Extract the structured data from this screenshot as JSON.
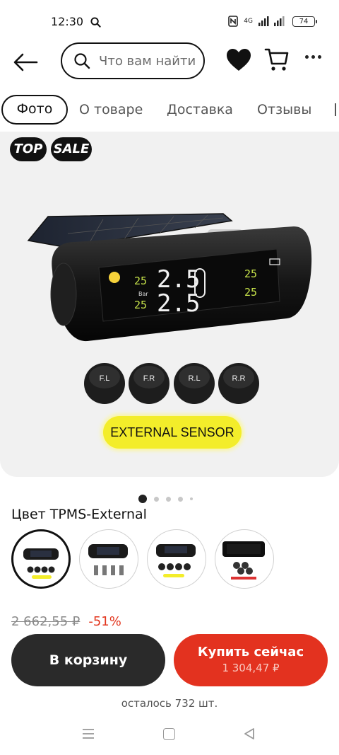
{
  "status_bar": {
    "time": "12:30",
    "network": "4G",
    "battery": "74",
    "icons": [
      "search-icon",
      "nfc-icon",
      "signal-icon",
      "battery-icon"
    ]
  },
  "header": {
    "search_placeholder": "Что вам найти",
    "icons": [
      "back-arrow-icon",
      "search-icon",
      "heart-icon",
      "cart-icon",
      "more-icon"
    ]
  },
  "tabs": [
    "Фото",
    "О товаре",
    "Доставка",
    "Отзывы"
  ],
  "gallery": {
    "badges": [
      "TOP",
      "SALE"
    ],
    "display": {
      "left_top": "25",
      "left_bottom": "25",
      "unit": "Bar",
      "main_top": "2.5",
      "main_bottom": "2.5",
      "right_top": "25",
      "right_bottom": "25"
    },
    "sensors": [
      "F.L",
      "F.R",
      "R.L",
      "R.R"
    ],
    "label": "EXTERNAL SENSOR",
    "current_slide": 1,
    "slide_count": 5
  },
  "product": {
    "color_line": "Цвет TPMS-External",
    "variant_names": [
      "variant-external",
      "variant-internal",
      "variant-external-x2",
      "variant-black"
    ],
    "old_price": "2 662,55 ₽",
    "discount": "-51%",
    "remaining": "осталось 732 шт."
  },
  "actions": {
    "cart_label": "В корзину",
    "buy_label": "Купить сейчас",
    "buy_price": "1 304,47 ₽"
  },
  "colors": {
    "accent": "#e3321f",
    "dark_button": "#2a2a2a",
    "sensor_label_bg": "#f3ed2a",
    "lcd_green": "#c7e34a"
  }
}
